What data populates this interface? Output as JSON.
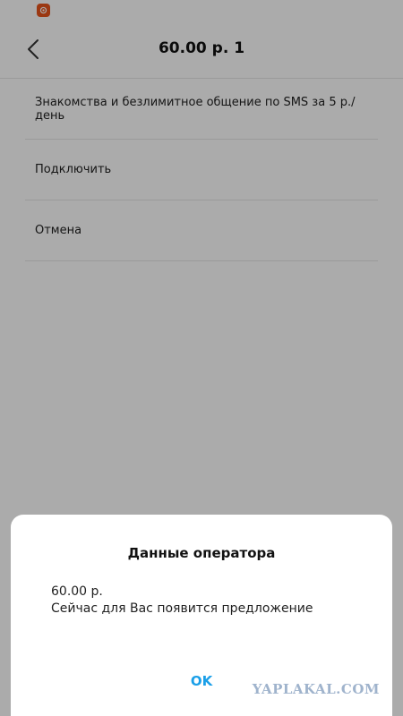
{
  "status_bar": {
    "app_icon": "notification-app-icon"
  },
  "header": {
    "back_icon": "chevron-left-icon",
    "title": "60.00 р. 1"
  },
  "menu": {
    "items": [
      {
        "label": "Знакомства и безлимитное общение по SMS за 5 р./день"
      },
      {
        "label": "Подключить"
      },
      {
        "label": "Отмена"
      }
    ]
  },
  "dialog": {
    "title": "Данные оператора",
    "message_line1": "60.00 р.",
    "message_line2": "Сейчас для Вас появится предложение",
    "ok_label": "OK"
  },
  "watermark": {
    "text": "YAPLAKAL.COM"
  },
  "colors": {
    "accent": "#1a9fe8",
    "app_icon": "#e8541c",
    "overlay": "rgba(0,0,0,0.33)"
  }
}
